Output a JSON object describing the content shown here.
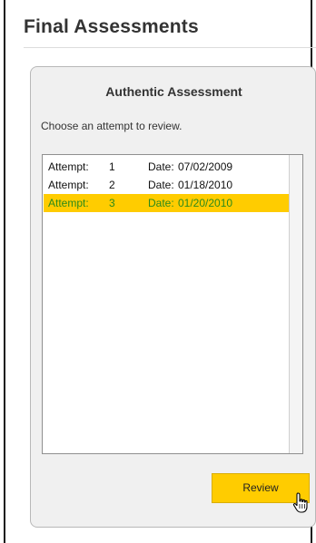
{
  "page": {
    "title": "Final Assessments"
  },
  "panel": {
    "title": "Authentic Assessment",
    "instruction": "Choose an attempt to review."
  },
  "attempts": {
    "items": [
      {
        "attempt_label": "Attempt:",
        "number": "1",
        "date_label": "Date:",
        "date": "07/02/2009",
        "selected": false
      },
      {
        "attempt_label": "Attempt:",
        "number": "2",
        "date_label": "Date:",
        "date": "01/18/2010",
        "selected": false
      },
      {
        "attempt_label": "Attempt:",
        "number": "3",
        "date_label": "Date:",
        "date": "01/20/2010",
        "selected": true
      }
    ]
  },
  "actions": {
    "review_label": "Review"
  },
  "colors": {
    "accent": "#ffcc00",
    "selected_text": "#2a8a1a"
  },
  "icons": {
    "cursor": "hand-pointer-icon"
  }
}
